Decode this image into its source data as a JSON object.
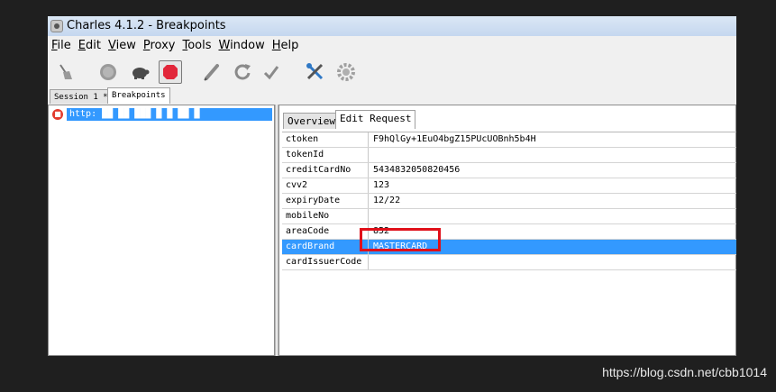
{
  "window": {
    "title": "Charles 4.1.2 - Breakpoints"
  },
  "menu": [
    {
      "ul": "F",
      "rest": "ile"
    },
    {
      "ul": "E",
      "rest": "dit"
    },
    {
      "ul": "V",
      "rest": "iew"
    },
    {
      "ul": "P",
      "rest": "roxy"
    },
    {
      "ul": "T",
      "rest": "ools"
    },
    {
      "ul": "W",
      "rest": "indow"
    },
    {
      "ul": "H",
      "rest": "elp"
    }
  ],
  "toolbar": {
    "icons": [
      "broom-icon",
      "stop-circle-icon",
      "turtle-icon",
      "record-stop-icon",
      "pen-icon",
      "refresh-icon",
      "check-icon",
      "tools-icon",
      "gear-icon"
    ]
  },
  "session_tabs": [
    {
      "label": "Session 1 *",
      "active": false
    },
    {
      "label": "Breakpoints",
      "active": true
    }
  ],
  "tree": {
    "url": "http:"
  },
  "detail_tabs": [
    {
      "label": "Overview",
      "active": false
    },
    {
      "label": "Edit Request",
      "active": true
    }
  ],
  "params": [
    {
      "key": "ctoken",
      "value": "F9hQlGy+1EuO4bgZ15PUcUOBnh5b4H"
    },
    {
      "key": "tokenId",
      "value": ""
    },
    {
      "key": "creditCardNo",
      "value": "5434832050820456"
    },
    {
      "key": "cvv2",
      "value": "123"
    },
    {
      "key": "expiryDate",
      "value": "12/22"
    },
    {
      "key": "mobileNo",
      "value": ""
    },
    {
      "key": "areaCode",
      "value": "852"
    },
    {
      "key": "cardBrand",
      "value": "MASTERCARD",
      "selected": true
    },
    {
      "key": "cardIssuerCode",
      "value": ""
    }
  ],
  "watermark": "https://blog.csdn.net/cbb1014",
  "colors": {
    "selection": "#3399ff",
    "highlight": "#e0101a"
  }
}
